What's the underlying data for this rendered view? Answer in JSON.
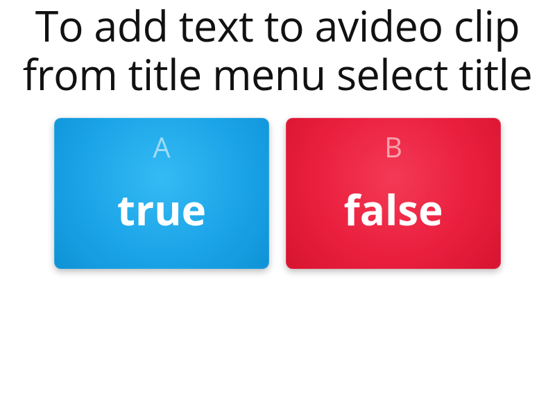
{
  "question": "To add text to avideo clip from title menu select title",
  "answers": [
    {
      "letter": "A",
      "label": "true"
    },
    {
      "letter": "B",
      "label": "false"
    }
  ]
}
